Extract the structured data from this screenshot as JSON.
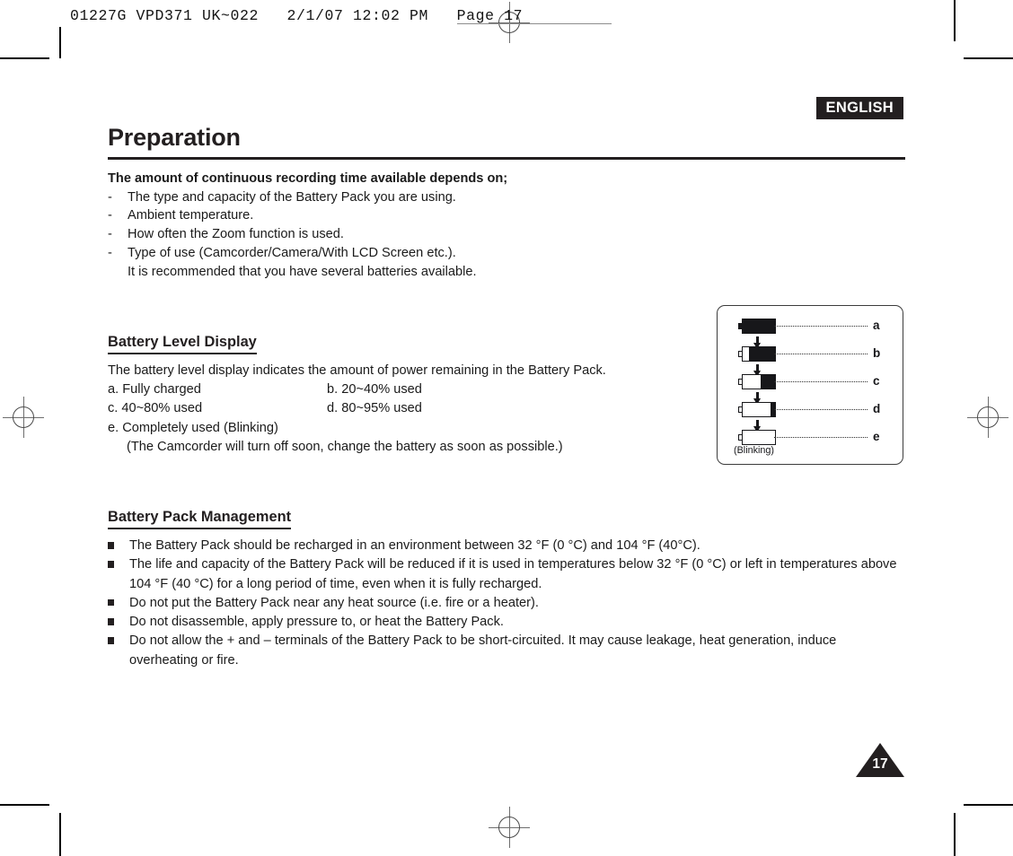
{
  "print_header": {
    "text": "01227G VPD371 UK~022   2/1/07 12:02 PM   Page 17"
  },
  "language_badge": "ENGLISH",
  "chapter_title": "Preparation",
  "lead_section": {
    "heading": "The amount of continuous recording time available depends on;",
    "dash": "-",
    "items": [
      "The type and capacity of the Battery Pack you are using.",
      "Ambient temperature.",
      "How often the Zoom function is used.",
      "Type of use (Camcorder/Camera/With LCD Screen etc.)."
    ],
    "continuation": "It is recommended that you have several batteries available."
  },
  "battery_level_display": {
    "heading": "Battery Level Display",
    "intro": "The battery level display indicates the amount of power remaining in the Battery Pack.",
    "row1_left": "a. Fully charged",
    "row1_right": "b. 20~40% used",
    "row2_left": "c. 40~80% used",
    "row2_right": "d. 80~95% used",
    "row3": "e. Completely used (Blinking)",
    "row3_note": "(The Camcorder will turn off soon, change the battery as soon as possible.)"
  },
  "battery_diagram": {
    "blinking_label": "(Blinking)",
    "levels": [
      {
        "label": "a",
        "fill_percent": 100
      },
      {
        "label": "b",
        "fill_percent": 80
      },
      {
        "label": "c",
        "fill_percent": 45
      },
      {
        "label": "d",
        "fill_percent": 14
      },
      {
        "label": "e",
        "fill_percent": 0
      }
    ]
  },
  "battery_pack_management": {
    "heading": "Battery Pack Management",
    "bullets": [
      "The Battery Pack should be recharged in an environment between 32 °F (0 °C) and 104 °F (40°C).",
      "The life and capacity of the Battery Pack will be reduced if it is used in temperatures below 32 °F (0 °C) or left in temperatures above 104 °F (40 °C) for a long period of time, even when it is fully recharged.",
      "Do not put the Battery Pack near any heat source (i.e. fire or a heater).",
      "Do not disassemble, apply pressure to, or heat the Battery Pack.",
      "Do not allow the + and – terminals of the Battery Pack to be short-circuited. It may cause leakage, heat generation, induce overheating or fire."
    ]
  },
  "page_number": "17",
  "colors": {
    "ink": "#231f20",
    "rule": "#231f20",
    "badge_bg": "#231f20",
    "badge_text": "#ffffff"
  }
}
